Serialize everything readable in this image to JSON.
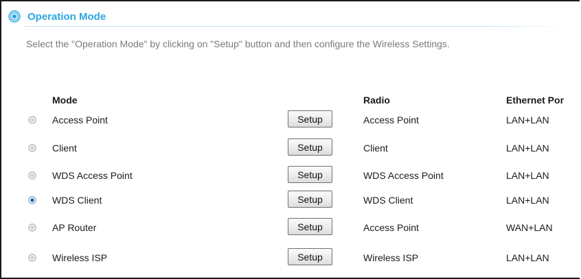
{
  "header": {
    "title": "Operation Mode",
    "icon": "radio-target-icon",
    "accent_color": "#2aa6e0"
  },
  "description": "Select the \"Operation Mode\" by clicking on \"Setup\" button and then configure the Wireless Settings.",
  "table": {
    "columns": {
      "mode": "Mode",
      "radio": "Radio",
      "ethernet": "Ethernet Por"
    },
    "setup_label": "Setup",
    "selected_index": 3,
    "rows": [
      {
        "mode": "Access Point",
        "radio": "Access Point",
        "ethernet": "LAN+LAN",
        "selected": false
      },
      {
        "mode": "Client",
        "radio": "Client",
        "ethernet": "LAN+LAN",
        "selected": false
      },
      {
        "mode": "WDS Access Point",
        "radio": "WDS Access Point",
        "ethernet": "LAN+LAN",
        "selected": false
      },
      {
        "mode": "WDS Client",
        "radio": "WDS Client",
        "ethernet": "LAN+LAN",
        "selected": true
      },
      {
        "mode": "AP Router",
        "radio": "Access Point",
        "ethernet": "WAN+LAN",
        "selected": false
      },
      {
        "mode": "Wireless ISP",
        "radio": "Wireless ISP",
        "ethernet": "LAN+LAN",
        "selected": false
      }
    ]
  }
}
